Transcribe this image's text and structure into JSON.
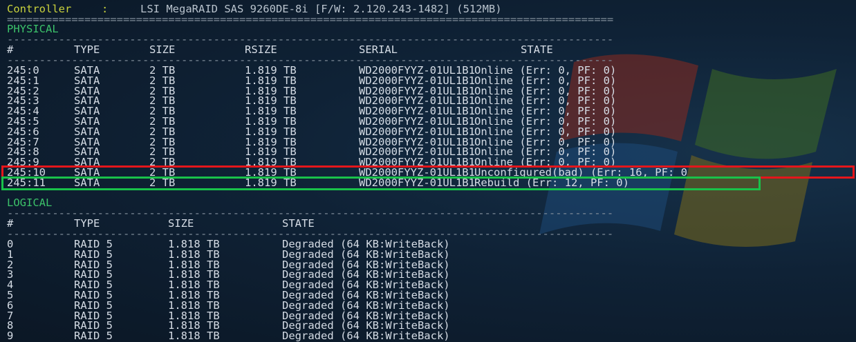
{
  "controller": {
    "label": "Controller",
    "sep": ":",
    "value": "LSI MegaRAID SAS 9260DE-8i [F/W: 2.120.243-1482] (512MB)"
  },
  "separator": "==============================================================================================",
  "dash_line": "----------------------------------------------------------------------------------------------",
  "physical": {
    "title": "PHYSICAL",
    "headers": {
      "id": "#",
      "type": "TYPE",
      "size": "SIZE",
      "rsize": "RSIZE",
      "serial": "SERIAL",
      "state": "STATE"
    },
    "rows": [
      {
        "id": "245:0",
        "type": "SATA",
        "size": "2 TB",
        "rsize": "1.819 TB",
        "serial": "WD2000FYYZ-01UL1B1",
        "state": "Online (Err: 0, PF: 0)"
      },
      {
        "id": "245:1",
        "type": "SATA",
        "size": "2 TB",
        "rsize": "1.819 TB",
        "serial": "WD2000FYYZ-01UL1B1",
        "state": "Online (Err: 0, PF: 0)"
      },
      {
        "id": "245:2",
        "type": "SATA",
        "size": "2 TB",
        "rsize": "1.819 TB",
        "serial": "WD2000FYYZ-01UL1B1",
        "state": "Online (Err: 0, PF: 0)"
      },
      {
        "id": "245:3",
        "type": "SATA",
        "size": "2 TB",
        "rsize": "1.819 TB",
        "serial": "WD2000FYYZ-01UL1B1",
        "state": "Online (Err: 0, PF: 0)"
      },
      {
        "id": "245:4",
        "type": "SATA",
        "size": "2 TB",
        "rsize": "1.819 TB",
        "serial": "WD2000FYYZ-01UL1B1",
        "state": "Online (Err: 0, PF: 0)"
      },
      {
        "id": "245:5",
        "type": "SATA",
        "size": "2 TB",
        "rsize": "1.819 TB",
        "serial": "WD2000FYYZ-01UL1B1",
        "state": "Online (Err: 0, PF: 0)"
      },
      {
        "id": "245:6",
        "type": "SATA",
        "size": "2 TB",
        "rsize": "1.819 TB",
        "serial": "WD2000FYYZ-01UL1B1",
        "state": "Online (Err: 0, PF: 0)"
      },
      {
        "id": "245:7",
        "type": "SATA",
        "size": "2 TB",
        "rsize": "1.819 TB",
        "serial": "WD2000FYYZ-01UL1B1",
        "state": "Online (Err: 0, PF: 0)"
      },
      {
        "id": "245:8",
        "type": "SATA",
        "size": "2 TB",
        "rsize": "1.819 TB",
        "serial": "WD2000FYYZ-01UL1B1",
        "state": "Online (Err: 0, PF: 0)"
      },
      {
        "id": "245:9",
        "type": "SATA",
        "size": "2 TB",
        "rsize": "1.819 TB",
        "serial": "WD2000FYYZ-01UL1B1",
        "state": "Online (Err: 0, PF: 0)"
      },
      {
        "id": "245:10",
        "type": "SATA",
        "size": "2 TB",
        "rsize": "1.819 TB",
        "serial": "WD2000FYYZ-01UL1B1",
        "state": "Unconfigured(bad) (Err: 16, PF: 0"
      },
      {
        "id": "245:11",
        "type": "SATA",
        "size": "2 TB",
        "rsize": "1.819 TB",
        "serial": "WD2000FYYZ-01UL1B1",
        "state": "Rebuild (Err: 12, PF: 0)"
      }
    ]
  },
  "logical": {
    "title": "LOGICAL",
    "headers": {
      "id": "#",
      "type": "TYPE",
      "size": "SIZE",
      "state": "STATE"
    },
    "rows": [
      {
        "id": "0",
        "type": "RAID 5",
        "size": "1.818 TB",
        "state": "Degraded (64 KB:WriteBack)"
      },
      {
        "id": "1",
        "type": "RAID 5",
        "size": "1.818 TB",
        "state": "Degraded (64 KB:WriteBack)"
      },
      {
        "id": "2",
        "type": "RAID 5",
        "size": "1.818 TB",
        "state": "Degraded (64 KB:WriteBack)"
      },
      {
        "id": "3",
        "type": "RAID 5",
        "size": "1.818 TB",
        "state": "Degraded (64 KB:WriteBack)"
      },
      {
        "id": "4",
        "type": "RAID 5",
        "size": "1.818 TB",
        "state": "Degraded (64 KB:WriteBack)"
      },
      {
        "id": "5",
        "type": "RAID 5",
        "size": "1.818 TB",
        "state": "Degraded (64 KB:WriteBack)"
      },
      {
        "id": "6",
        "type": "RAID 5",
        "size": "1.818 TB",
        "state": "Degraded (64 KB:WriteBack)"
      },
      {
        "id": "7",
        "type": "RAID 5",
        "size": "1.818 TB",
        "state": "Degraded (64 KB:WriteBack)"
      },
      {
        "id": "8",
        "type": "RAID 5",
        "size": "1.818 TB",
        "state": "Degraded (64 KB:WriteBack)"
      },
      {
        "id": "9",
        "type": "RAID 5",
        "size": "1.818 TB",
        "state": "Degraded (64 KB:WriteBack)"
      }
    ]
  },
  "colors": {
    "failed_highlight": "#e5161b",
    "rebuild_highlight": "#19c24a",
    "section_title": "#3cc26a",
    "controller_label": "#c9d23c"
  }
}
